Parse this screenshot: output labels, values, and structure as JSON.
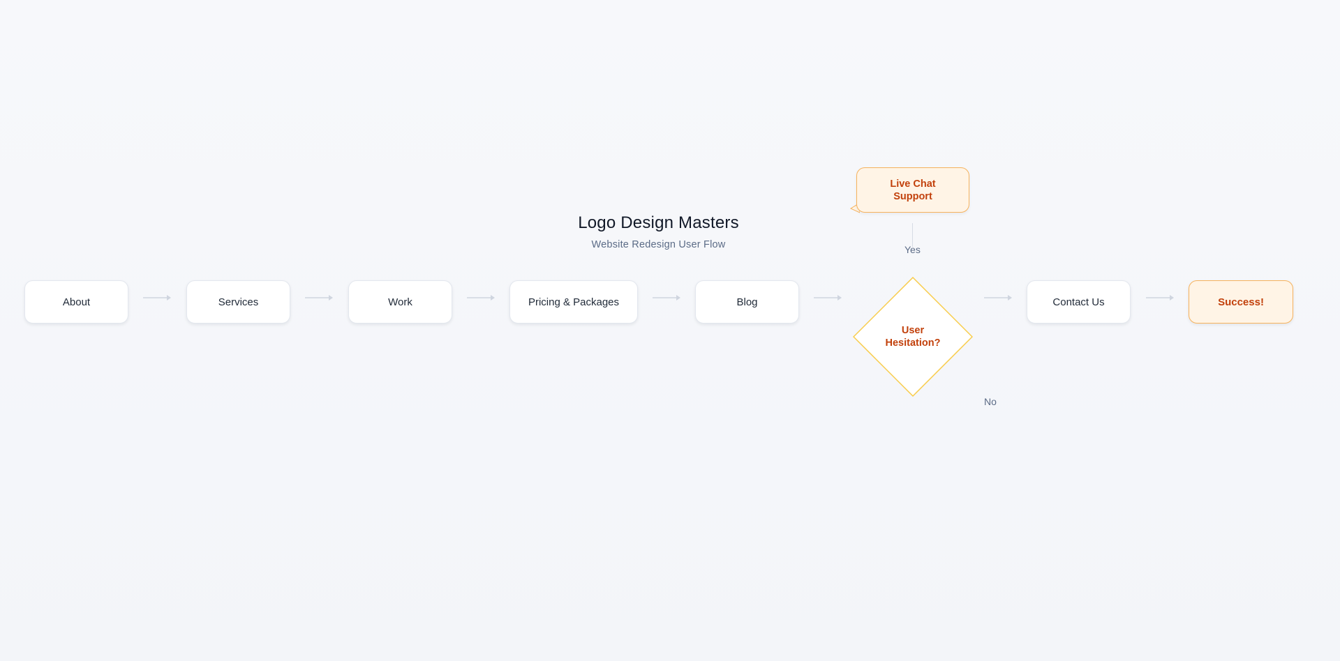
{
  "diagram": {
    "title": "Logo Design Masters",
    "subtitle": "Website Redesign User Flow",
    "steps": [
      {
        "label": "About"
      },
      {
        "label": "Services"
      },
      {
        "label": "Work"
      },
      {
        "label": "Pricing & Packages"
      },
      {
        "label": "Blog"
      }
    ],
    "decision": {
      "label": "User\nHesitation?"
    },
    "yes_branch": {
      "label": "Yes",
      "target": "Live Chat\nSupport"
    },
    "no_branch": {
      "label": "No"
    },
    "after_decision": [
      {
        "label": "Contact Us"
      }
    ],
    "end": {
      "label": "Success!"
    },
    "colors": {
      "background": "#f5f7fa",
      "node_border": "#e3e7ee",
      "node_text": "#1f2937",
      "accent_fill": "#fff4e6",
      "accent_border": "#f6b25c",
      "accent_text": "#c2410c",
      "decision_border": "#f8cc4a",
      "arrow": "#cfd5df",
      "muted_text": "#5b6b86"
    }
  }
}
